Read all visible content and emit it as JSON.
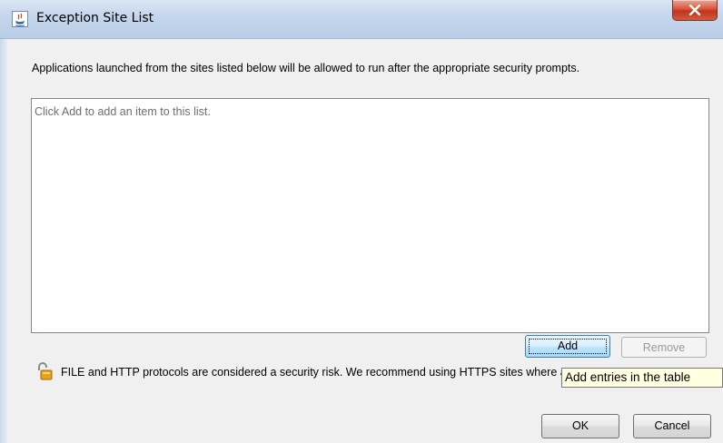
{
  "window": {
    "title": "Exception Site List",
    "close_label": "Close"
  },
  "description": "Applications launched from the sites listed below will be allowed to run after the appropriate security prompts.",
  "site_list": {
    "placeholder": "Click Add to add an item to this list.",
    "items": []
  },
  "buttons": {
    "add": "Add",
    "remove": "Remove",
    "ok": "OK",
    "cancel": "Cancel"
  },
  "warning": {
    "icon": "unlocked-padlock-icon",
    "text": "FILE and HTTP protocols are considered a security risk.  We recommend using HTTPS sites where available."
  },
  "tooltip": {
    "text": "Add entries in the table"
  },
  "colors": {
    "close_button": "#c2331a",
    "add_button_focus": "#3c7fb1",
    "tooltip_bg": "#ffffe1"
  }
}
